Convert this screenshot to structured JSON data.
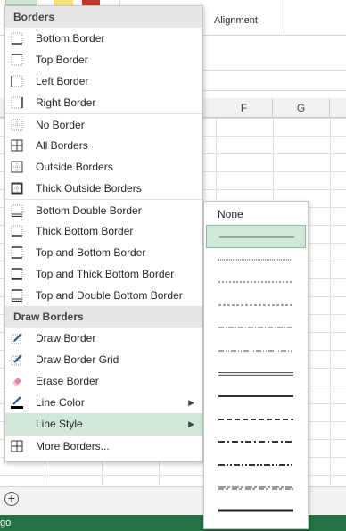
{
  "ribbon": {
    "alignment_label": "Alignment"
  },
  "columns": [
    "F",
    "G"
  ],
  "status_bar": {
    "text": "go"
  },
  "menu": {
    "borders_header": "Borders",
    "draw_header": "Draw Borders",
    "border_items": [
      {
        "label": "Bottom Border",
        "icon": "bottom-border-icon"
      },
      {
        "label": "Top Border",
        "icon": "top-border-icon"
      },
      {
        "label": "Left Border",
        "icon": "left-border-icon"
      },
      {
        "label": "Right Border",
        "icon": "right-border-icon"
      },
      {
        "label": "No Border",
        "icon": "no-border-icon"
      },
      {
        "label": "All Borders",
        "icon": "all-borders-icon"
      },
      {
        "label": "Outside Borders",
        "icon": "outside-borders-icon"
      },
      {
        "label": "Thick Outside Borders",
        "icon": "thick-outside-borders-icon"
      },
      {
        "label": "Bottom Double Border",
        "icon": "bottom-double-border-icon"
      },
      {
        "label": "Thick Bottom Border",
        "icon": "thick-bottom-border-icon"
      },
      {
        "label": "Top and Bottom Border",
        "icon": "top-bottom-border-icon"
      },
      {
        "label": "Top and Thick Bottom Border",
        "icon": "top-thick-bottom-border-icon"
      },
      {
        "label": "Top and Double Bottom Border",
        "icon": "top-double-bottom-border-icon"
      }
    ],
    "draw_items": [
      {
        "label": "Draw Border",
        "icon": "draw-border-pencil-icon"
      },
      {
        "label": "Draw Border Grid",
        "icon": "draw-border-grid-icon"
      },
      {
        "label": "Erase Border",
        "icon": "eraser-icon"
      },
      {
        "label": "Line Color",
        "icon": "line-color-icon"
      },
      {
        "label": "Line Style",
        "icon": "line-style-icon"
      },
      {
        "label": "More Borders...",
        "icon": "more-borders-icon"
      }
    ]
  },
  "line_style_submenu": {
    "none_label": "None",
    "selected_index": 0,
    "styles": [
      "hairline",
      "dotted",
      "dashed-fine",
      "dashed",
      "dash-dot",
      "dash-dot-dot",
      "double",
      "medium",
      "medium-dashed",
      "medium-dash-dot",
      "medium-dash-dot-dot",
      "slanted-dash-dot",
      "thick"
    ]
  },
  "colors": {
    "accent_green": "#217346",
    "highlight": "#cfe8d8"
  }
}
